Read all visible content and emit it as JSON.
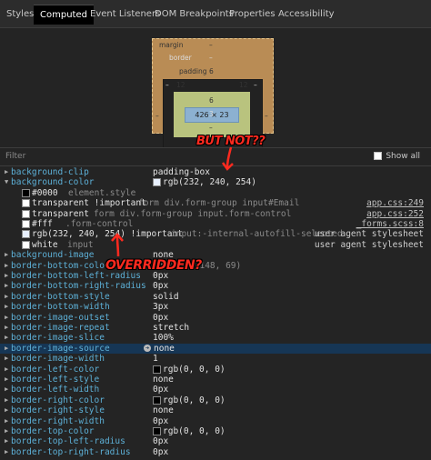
{
  "tabs": [
    "Styles",
    "Computed",
    "Event Listeners",
    "DOM Breakpoints",
    "Properties",
    "Accessibility"
  ],
  "box_model": {
    "margin_label": "margin",
    "margin_top": "–",
    "margin_bottom": "–",
    "margin_left": "–",
    "margin_right": "–",
    "border_label": "border",
    "border_top": "–",
    "border_bottom": "–",
    "border_left": "–",
    "border_right": "–",
    "padding_label": "padding",
    "padding_top": "6",
    "padding_bottom": "6",
    "padding_left": "12",
    "padding_right": "12",
    "content": "426 × 23",
    "bottom_value": "3"
  },
  "filter": {
    "placeholder": "Filter",
    "show_all": "Show all"
  },
  "properties": [
    {
      "name": "background-clip",
      "value": "padding-box"
    },
    {
      "name": "background-color",
      "value": "rgb(232, 240, 254)",
      "swatch": "#e8f0fe"
    },
    {
      "name": "background-image",
      "value": "none"
    },
    {
      "name": "border-bottom-color",
      "value": "rgb(204, 148, 69)"
    },
    {
      "name": "border-bottom-left-radius",
      "value": "0px"
    },
    {
      "name": "border-bottom-right-radius",
      "value": "0px"
    },
    {
      "name": "border-bottom-style",
      "value": "solid"
    },
    {
      "name": "border-bottom-width",
      "value": "3px"
    },
    {
      "name": "border-image-outset",
      "value": "0px"
    },
    {
      "name": "border-image-repeat",
      "value": "stretch"
    },
    {
      "name": "border-image-slice",
      "value": "100%"
    },
    {
      "name": "border-image-source",
      "value": "none"
    },
    {
      "name": "border-image-width",
      "value": "1"
    },
    {
      "name": "border-left-color",
      "value": "rgb(0, 0, 0)",
      "swatch": "#000000"
    },
    {
      "name": "border-left-style",
      "value": "none"
    },
    {
      "name": "border-left-width",
      "value": "0px"
    },
    {
      "name": "border-right-color",
      "value": "rgb(0, 0, 0)",
      "swatch": "#000000"
    },
    {
      "name": "border-right-style",
      "value": "none"
    },
    {
      "name": "border-right-width",
      "value": "0px"
    },
    {
      "name": "border-top-color",
      "value": "rgb(0, 0, 0)",
      "swatch": "#000000"
    },
    {
      "name": "border-top-left-radius",
      "value": "0px"
    },
    {
      "name": "border-top-right-radius",
      "value": "0px"
    }
  ],
  "bg_color_rules": [
    {
      "value": "#0000",
      "selector": "element.style",
      "source": "",
      "swatch": "#000000"
    },
    {
      "value": "transparent !important",
      "selector": "form div.form-group input#Email",
      "source": "app.css:249",
      "swatch": "#ffffff"
    },
    {
      "value": "transparent",
      "selector": "form div.form-group input.form-control",
      "source": "app.css:252",
      "swatch": "#ffffff"
    },
    {
      "value": "#fff",
      "selector": ".form-control",
      "source": "_forms.scss:8",
      "swatch": "#ffffff"
    },
    {
      "value": "rgb(232, 240, 254) !important",
      "selector": "input:-internal-autofill-selected",
      "source": "user agent stylesheet",
      "swatch": "#e8f0fe"
    },
    {
      "value": "white",
      "selector": "input",
      "source": "user agent stylesheet",
      "swatch": "#ffffff"
    }
  ],
  "annotations": {
    "but_not": "BUT NOT??",
    "overridden": "OVERRIDDEN?"
  },
  "colors": {
    "annotation": "#ff2a1f",
    "property_name": "#5db0d7",
    "selected_row": "#163655"
  }
}
